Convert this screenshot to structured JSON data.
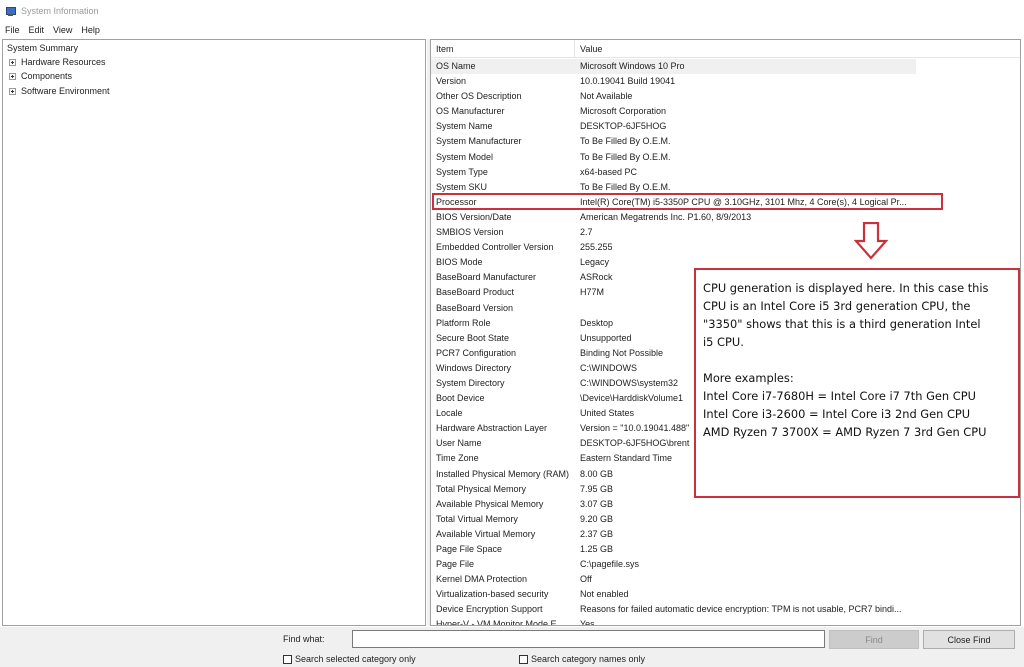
{
  "window": {
    "title": "System Information",
    "app_icon": "system-information-icon"
  },
  "menu": [
    "File",
    "Edit",
    "View",
    "Help"
  ],
  "tree": {
    "root": "System Summary",
    "nodes": [
      "Hardware Resources",
      "Components",
      "Software Environment"
    ]
  },
  "table": {
    "columns": [
      "Item",
      "Value"
    ],
    "selected_row": 0,
    "rows": [
      {
        "item": "OS Name",
        "value": "Microsoft Windows 10 Pro"
      },
      {
        "item": "Version",
        "value": "10.0.19041 Build 19041"
      },
      {
        "item": "Other OS Description",
        "value": "Not Available"
      },
      {
        "item": "OS Manufacturer",
        "value": "Microsoft Corporation"
      },
      {
        "item": "System Name",
        "value": "DESKTOP-6JF5HOG"
      },
      {
        "item": "System Manufacturer",
        "value": "To Be Filled By O.E.M."
      },
      {
        "item": "System Model",
        "value": "To Be Filled By O.E.M."
      },
      {
        "item": "System Type",
        "value": "x64-based PC"
      },
      {
        "item": "System SKU",
        "value": "To Be Filled By O.E.M."
      },
      {
        "item": "Processor",
        "value": "Intel(R) Core(TM) i5-3350P CPU @ 3.10GHz, 3101 Mhz, 4 Core(s), 4 Logical Pr..."
      },
      {
        "item": "BIOS Version/Date",
        "value": "American Megatrends Inc. P1.60, 8/9/2013"
      },
      {
        "item": "SMBIOS Version",
        "value": "2.7"
      },
      {
        "item": "Embedded Controller Version",
        "value": "255.255"
      },
      {
        "item": "BIOS Mode",
        "value": "Legacy"
      },
      {
        "item": "BaseBoard Manufacturer",
        "value": "ASRock"
      },
      {
        "item": "BaseBoard Product",
        "value": "H77M"
      },
      {
        "item": "BaseBoard Version",
        "value": ""
      },
      {
        "item": "Platform Role",
        "value": "Desktop"
      },
      {
        "item": "Secure Boot State",
        "value": "Unsupported"
      },
      {
        "item": "PCR7 Configuration",
        "value": "Binding Not Possible"
      },
      {
        "item": "Windows Directory",
        "value": "C:\\WINDOWS"
      },
      {
        "item": "System Directory",
        "value": "C:\\WINDOWS\\system32"
      },
      {
        "item": "Boot Device",
        "value": "\\Device\\HarddiskVolume1"
      },
      {
        "item": "Locale",
        "value": "United States"
      },
      {
        "item": "Hardware Abstraction Layer",
        "value": "Version = \"10.0.19041.488\""
      },
      {
        "item": "User Name",
        "value": "DESKTOP-6JF5HOG\\brent"
      },
      {
        "item": "Time Zone",
        "value": "Eastern Standard Time"
      },
      {
        "item": "Installed Physical Memory (RAM)",
        "value": "8.00 GB"
      },
      {
        "item": "Total Physical Memory",
        "value": "7.95 GB"
      },
      {
        "item": "Available Physical Memory",
        "value": "3.07 GB"
      },
      {
        "item": "Total Virtual Memory",
        "value": "9.20 GB"
      },
      {
        "item": "Available Virtual Memory",
        "value": "2.37 GB"
      },
      {
        "item": "Page File Space",
        "value": "1.25 GB"
      },
      {
        "item": "Page File",
        "value": "C:\\pagefile.sys"
      },
      {
        "item": "Kernel DMA Protection",
        "value": "Off"
      },
      {
        "item": "Virtualization-based security",
        "value": "Not enabled"
      },
      {
        "item": "Device Encryption Support",
        "value": "Reasons for failed automatic device encryption: TPM is not usable, PCR7 bindi..."
      },
      {
        "item": "Hyper-V - VM Monitor Mode E...",
        "value": "Yes"
      }
    ]
  },
  "annotation": {
    "highlight_color": "#c8323c",
    "arrow_icon": "down-arrow-outline-icon",
    "callout_lines": [
      "CPU generation is displayed here. In this case this",
      "CPU is an Intel Core i5 3rd generation CPU, the",
      "\"3350\" shows that this is a third generation Intel",
      "i5 CPU.",
      "",
      "More examples:",
      "Intel Core i7-7680H = Intel Core i7 7th Gen CPU",
      "Intel Core i3-2600 = Intel Core i3 2nd Gen CPU",
      "AMD Ryzen 7 3700X = AMD Ryzen 7 3rd Gen CPU"
    ]
  },
  "find": {
    "label": "Find what:",
    "value": "",
    "find_button": "Find",
    "close_button": "Close Find",
    "search_selected": "Search selected category only",
    "search_names": "Search category names only"
  }
}
